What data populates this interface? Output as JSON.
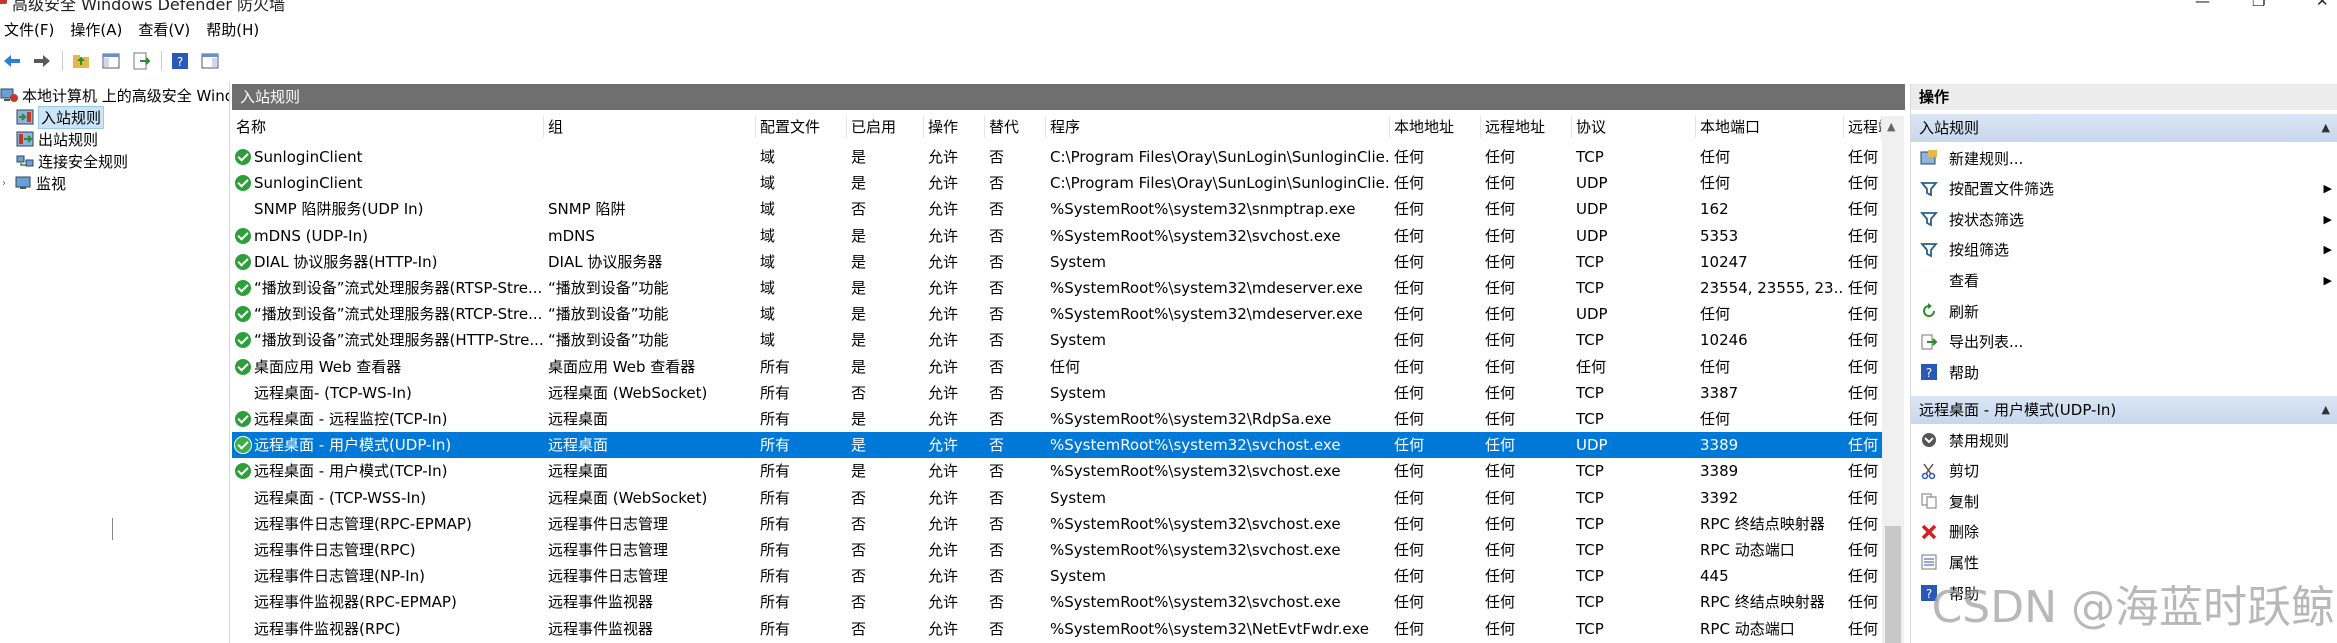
{
  "window": {
    "title": "高级安全 Windows Defender 防火墙"
  },
  "menu": [
    "文件(F)",
    "操作(A)",
    "查看(V)",
    "帮助(H)"
  ],
  "tree": {
    "root": "本地计算机 上的高级安全 Windows",
    "inbound": "入站规则",
    "outbound": "出站规则",
    "connection_security": "连接安全规则",
    "monitor": "监视"
  },
  "center": {
    "header": "入站规则",
    "columns": [
      "名称",
      "组",
      "配置文件",
      "已启用",
      "操作",
      "替代",
      "程序",
      "本地地址",
      "远程地址",
      "协议",
      "本地端口",
      "远程端"
    ],
    "rows": [
      {
        "enabled_icon": true,
        "name": "SunloginClient",
        "group": "",
        "profile": "域",
        "enabled": "是",
        "action": "允许",
        "override": "否",
        "program": "C:\\Program Files\\Oray\\SunLogin\\SunloginClie...",
        "local_addr": "任何",
        "remote_addr": "任何",
        "protocol": "TCP",
        "local_port": "任何",
        "remote_port": "任何"
      },
      {
        "enabled_icon": true,
        "name": "SunloginClient",
        "group": "",
        "profile": "域",
        "enabled": "是",
        "action": "允许",
        "override": "否",
        "program": "C:\\Program Files\\Oray\\SunLogin\\SunloginClie...",
        "local_addr": "任何",
        "remote_addr": "任何",
        "protocol": "UDP",
        "local_port": "任何",
        "remote_port": "任何"
      },
      {
        "enabled_icon": false,
        "name": "SNMP 陷阱服务(UDP In)",
        "group": "SNMP 陷阱",
        "profile": "域",
        "enabled": "否",
        "action": "允许",
        "override": "否",
        "program": "%SystemRoot%\\system32\\snmptrap.exe",
        "local_addr": "任何",
        "remote_addr": "任何",
        "protocol": "UDP",
        "local_port": "162",
        "remote_port": "任何"
      },
      {
        "enabled_icon": true,
        "name": "mDNS (UDP-In)",
        "group": "mDNS",
        "profile": "域",
        "enabled": "是",
        "action": "允许",
        "override": "否",
        "program": "%SystemRoot%\\system32\\svchost.exe",
        "local_addr": "任何",
        "remote_addr": "任何",
        "protocol": "UDP",
        "local_port": "5353",
        "remote_port": "任何"
      },
      {
        "enabled_icon": true,
        "name": "DIAL 协议服务器(HTTP-In)",
        "group": "DIAL 协议服务器",
        "profile": "域",
        "enabled": "是",
        "action": "允许",
        "override": "否",
        "program": "System",
        "local_addr": "任何",
        "remote_addr": "任何",
        "protocol": "TCP",
        "local_port": "10247",
        "remote_port": "任何"
      },
      {
        "enabled_icon": true,
        "name": "“播放到设备”流式处理服务器(RTSP-Stre...",
        "group": "“播放到设备”功能",
        "profile": "域",
        "enabled": "是",
        "action": "允许",
        "override": "否",
        "program": "%SystemRoot%\\system32\\mdeserver.exe",
        "local_addr": "任何",
        "remote_addr": "任何",
        "protocol": "TCP",
        "local_port": "23554, 23555, 23...",
        "remote_port": "任何"
      },
      {
        "enabled_icon": true,
        "name": "“播放到设备”流式处理服务器(RTCP-Stre...",
        "group": "“播放到设备”功能",
        "profile": "域",
        "enabled": "是",
        "action": "允许",
        "override": "否",
        "program": "%SystemRoot%\\system32\\mdeserver.exe",
        "local_addr": "任何",
        "remote_addr": "任何",
        "protocol": "UDP",
        "local_port": "任何",
        "remote_port": "任何"
      },
      {
        "enabled_icon": true,
        "name": "“播放到设备”流式处理服务器(HTTP-Stre...",
        "group": "“播放到设备”功能",
        "profile": "域",
        "enabled": "是",
        "action": "允许",
        "override": "否",
        "program": "System",
        "local_addr": "任何",
        "remote_addr": "任何",
        "protocol": "TCP",
        "local_port": "10246",
        "remote_port": "任何"
      },
      {
        "enabled_icon": true,
        "name": "桌面应用 Web 查看器",
        "group": "桌面应用 Web 查看器",
        "profile": "所有",
        "enabled": "是",
        "action": "允许",
        "override": "否",
        "program": "任何",
        "local_addr": "任何",
        "remote_addr": "任何",
        "protocol": "任何",
        "local_port": "任何",
        "remote_port": "任何"
      },
      {
        "enabled_icon": false,
        "name": "远程桌面- (TCP-WS-In)",
        "group": "远程桌面 (WebSocket)",
        "profile": "所有",
        "enabled": "否",
        "action": "允许",
        "override": "否",
        "program": "System",
        "local_addr": "任何",
        "remote_addr": "任何",
        "protocol": "TCP",
        "local_port": "3387",
        "remote_port": "任何"
      },
      {
        "enabled_icon": true,
        "name": "远程桌面 - 远程监控(TCP-In)",
        "group": "远程桌面",
        "profile": "所有",
        "enabled": "是",
        "action": "允许",
        "override": "否",
        "program": "%SystemRoot%\\system32\\RdpSa.exe",
        "local_addr": "任何",
        "remote_addr": "任何",
        "protocol": "TCP",
        "local_port": "任何",
        "remote_port": "任何"
      },
      {
        "enabled_icon": true,
        "selected": true,
        "name": "远程桌面 - 用户模式(UDP-In)",
        "group": "远程桌面",
        "profile": "所有",
        "enabled": "是",
        "action": "允许",
        "override": "否",
        "program": "%SystemRoot%\\system32\\svchost.exe",
        "local_addr": "任何",
        "remote_addr": "任何",
        "protocol": "UDP",
        "local_port": "3389",
        "remote_port": "任何"
      },
      {
        "enabled_icon": true,
        "name": "远程桌面 - 用户模式(TCP-In)",
        "group": "远程桌面",
        "profile": "所有",
        "enabled": "是",
        "action": "允许",
        "override": "否",
        "program": "%SystemRoot%\\system32\\svchost.exe",
        "local_addr": "任何",
        "remote_addr": "任何",
        "protocol": "TCP",
        "local_port": "3389",
        "remote_port": "任何"
      },
      {
        "enabled_icon": false,
        "name": "远程桌面 - (TCP-WSS-In)",
        "group": "远程桌面 (WebSocket)",
        "profile": "所有",
        "enabled": "否",
        "action": "允许",
        "override": "否",
        "program": "System",
        "local_addr": "任何",
        "remote_addr": "任何",
        "protocol": "TCP",
        "local_port": "3392",
        "remote_port": "任何"
      },
      {
        "enabled_icon": false,
        "name": "远程事件日志管理(RPC-EPMAP)",
        "group": "远程事件日志管理",
        "profile": "所有",
        "enabled": "否",
        "action": "允许",
        "override": "否",
        "program": "%SystemRoot%\\system32\\svchost.exe",
        "local_addr": "任何",
        "remote_addr": "任何",
        "protocol": "TCP",
        "local_port": "RPC 终结点映射器",
        "remote_port": "任何"
      },
      {
        "enabled_icon": false,
        "name": "远程事件日志管理(RPC)",
        "group": "远程事件日志管理",
        "profile": "所有",
        "enabled": "否",
        "action": "允许",
        "override": "否",
        "program": "%SystemRoot%\\system32\\svchost.exe",
        "local_addr": "任何",
        "remote_addr": "任何",
        "protocol": "TCP",
        "local_port": "RPC 动态端口",
        "remote_port": "任何"
      },
      {
        "enabled_icon": false,
        "name": "远程事件日志管理(NP-In)",
        "group": "远程事件日志管理",
        "profile": "所有",
        "enabled": "否",
        "action": "允许",
        "override": "否",
        "program": "System",
        "local_addr": "任何",
        "remote_addr": "任何",
        "protocol": "TCP",
        "local_port": "445",
        "remote_port": "任何"
      },
      {
        "enabled_icon": false,
        "name": "远程事件监视器(RPC-EPMAP)",
        "group": "远程事件监视器",
        "profile": "所有",
        "enabled": "否",
        "action": "允许",
        "override": "否",
        "program": "%SystemRoot%\\system32\\svchost.exe",
        "local_addr": "任何",
        "remote_addr": "任何",
        "protocol": "TCP",
        "local_port": "RPC 终结点映射器",
        "remote_port": "任何"
      },
      {
        "enabled_icon": false,
        "name": "远程事件监视器(RPC)",
        "group": "远程事件监视器",
        "profile": "所有",
        "enabled": "否",
        "action": "允许",
        "override": "否",
        "program": "%SystemRoot%\\system32\\NetEvtFwdr.exe",
        "local_addr": "任何",
        "remote_addr": "任何",
        "protocol": "TCP",
        "local_port": "RPC 动态端口",
        "remote_port": "任何"
      }
    ]
  },
  "actions": {
    "header": "操作",
    "section1": "入站规则",
    "section1_items": [
      {
        "label": "新建规则...",
        "icon": "new-rule-icon"
      },
      {
        "label": "按配置文件筛选",
        "icon": "filter-icon",
        "submenu": true
      },
      {
        "label": "按状态筛选",
        "icon": "filter-icon",
        "submenu": true
      },
      {
        "label": "按组筛选",
        "icon": "filter-icon",
        "submenu": true
      },
      {
        "label": "查看",
        "icon": "",
        "submenu": true
      },
      {
        "label": "刷新",
        "icon": "refresh-icon"
      },
      {
        "label": "导出列表...",
        "icon": "export-icon"
      },
      {
        "label": "帮助",
        "icon": "help-icon"
      }
    ],
    "section2": "远程桌面 - 用户模式(UDP-In)",
    "section2_items": [
      {
        "label": "禁用规则",
        "icon": "disable-icon"
      },
      {
        "label": "剪切",
        "icon": "cut-icon"
      },
      {
        "label": "复制",
        "icon": "copy-icon"
      },
      {
        "label": "删除",
        "icon": "delete-icon"
      },
      {
        "label": "属性",
        "icon": "properties-icon"
      },
      {
        "label": "帮助",
        "icon": "help-icon"
      }
    ]
  },
  "watermark": "CSDN @海蓝时跃鲸",
  "colors": {
    "selection": "#0078d7",
    "panel_header": "#6f6f6f",
    "enabled_check": "#2e9e3a"
  }
}
